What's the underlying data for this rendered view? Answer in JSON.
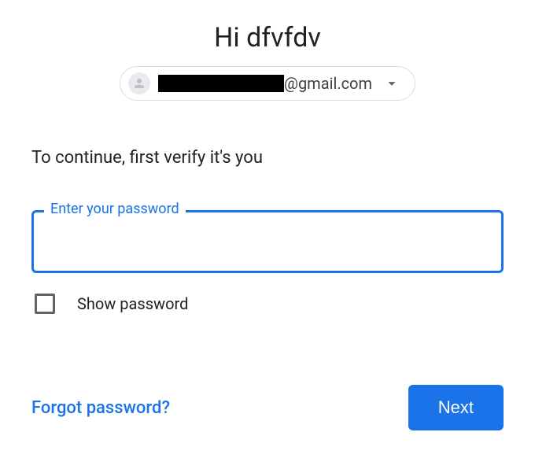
{
  "heading": "Hi dfvfdv",
  "account": {
    "email_domain": "@gmail.com"
  },
  "instruction": "To continue, first verify it's you",
  "password_field": {
    "label": "Enter your password",
    "value": ""
  },
  "show_password_label": "Show password",
  "forgot_link": "Forgot password?",
  "next_button": "Next"
}
